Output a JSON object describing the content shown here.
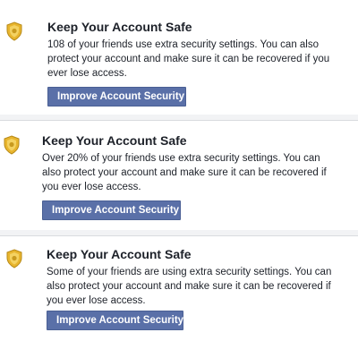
{
  "cards": [
    {
      "title": "Keep Your Account Safe",
      "desc_lines": [
        "108 of your friends use extra security settings. You can also",
        "protect your account and make sure it can be recovered if you",
        "ever lose access."
      ],
      "button": "Improve Account Security",
      "badge_icon": "shield-badge-icon"
    },
    {
      "title": "Keep Your Account Safe",
      "desc_lines": [
        "Over 20% of your friends use extra security settings. You can",
        "also protect your account and make sure it can be recovered if",
        "you ever lose access."
      ],
      "button": "Improve Account Security",
      "badge_icon": "shield-badge-icon"
    },
    {
      "title": "Keep Your Account Safe",
      "desc_lines": [
        "Some of your friends are using extra security settings. You can",
        "also protect your account and make sure it can be recovered if",
        "you ever lose access."
      ],
      "button": "Improve Account Security",
      "badge_icon": "shield-badge-icon"
    }
  ],
  "colors": {
    "button_bg": "#5a70a8",
    "badge_gold": "#e8b52e",
    "separator": "#d9dbdf"
  }
}
